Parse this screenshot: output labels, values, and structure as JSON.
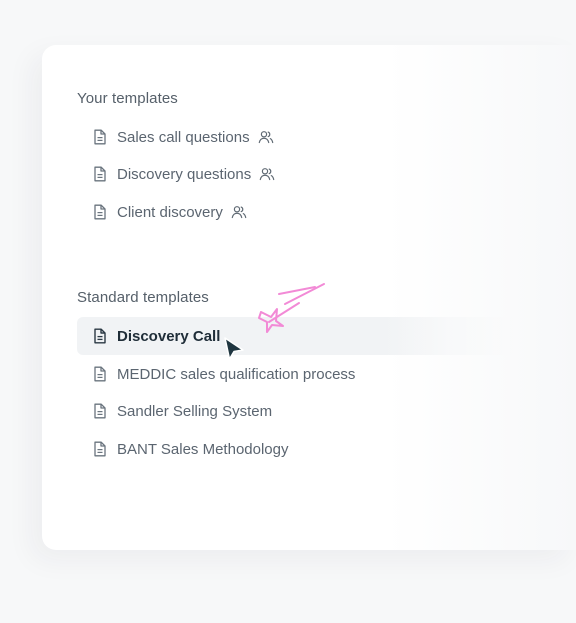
{
  "your_templates": {
    "heading": "Your templates",
    "items": [
      {
        "label": "Sales call questions",
        "icon": "document-icon",
        "shared_icon": "shared-users-icon"
      },
      {
        "label": "Discovery questions",
        "icon": "document-icon",
        "shared_icon": "shared-users-icon"
      },
      {
        "label": "Client discovery",
        "icon": "document-icon",
        "shared_icon": "shared-users-icon"
      }
    ]
  },
  "standard_templates": {
    "heading": "Standard templates",
    "selected_item": "Discovery Call",
    "items": [
      {
        "label": "Discovery Call",
        "icon": "document-icon"
      },
      {
        "label": "MEDDIC sales qualification process",
        "icon": "document-icon"
      },
      {
        "label": "Sandler Selling System",
        "icon": "document-icon"
      },
      {
        "label": "BANT Sales Methodology",
        "icon": "document-icon"
      }
    ]
  },
  "colors": {
    "background": "#f7f8f9",
    "panel": "#ffffff",
    "selected_row": "#f1f3f5",
    "sparkle": "#f28ad6",
    "cursor": "#1f3640"
  }
}
